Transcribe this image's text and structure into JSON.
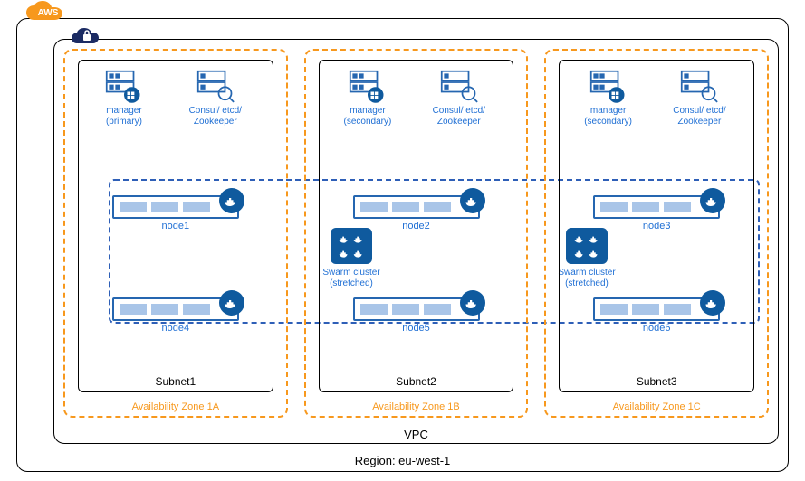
{
  "region_label": "Region: eu-west-1",
  "vpc_label": "VPC",
  "aws_badge": "AWS",
  "swarm_label": "Swarm cluster (stretched)",
  "zones": [
    {
      "az_label": "Availability Zone 1A",
      "subnet_label": "Subnet1",
      "manager_label": "manager (primary)",
      "consul_label": "Consul/ etcd/ Zookeeper",
      "nodes": [
        "node1",
        "node4"
      ]
    },
    {
      "az_label": "Availability Zone 1B",
      "subnet_label": "Subnet2",
      "manager_label": "manager (secondary)",
      "consul_label": "Consul/ etcd/ Zookeeper",
      "nodes": [
        "node2",
        "node5"
      ]
    },
    {
      "az_label": "Availability Zone 1C",
      "subnet_label": "Subnet3",
      "manager_label": "manager (secondary)",
      "consul_label": "Consul/ etcd/ Zookeeper",
      "nodes": [
        "node3",
        "node6"
      ]
    }
  ]
}
